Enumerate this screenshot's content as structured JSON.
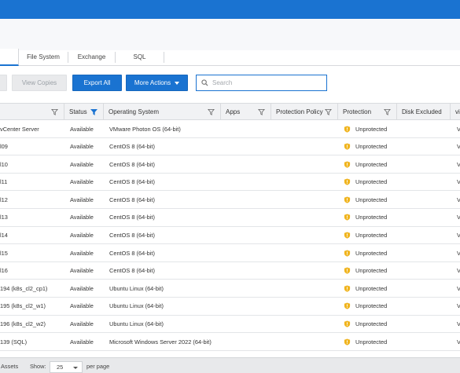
{
  "tabs": [
    {
      "label": "File System"
    },
    {
      "label": "Exchange"
    },
    {
      "label": "SQL"
    }
  ],
  "toolbar": {
    "view_copies_label": "View Copies",
    "export_all_label": "Export All",
    "more_actions_label": "More Actions",
    "search_placeholder": "Search"
  },
  "columns": {
    "status": "Status",
    "operating_system": "Operating System",
    "apps": "Apps",
    "protection_policy": "Protection Policy",
    "protection": "Protection",
    "disk_excluded": "Disk Excluded",
    "last": "vi"
  },
  "rows": [
    {
      "name": "vCenter Server",
      "status": "Available",
      "os": "VMware Photon OS (64-bit)",
      "protection": "Unprotected",
      "last": "V"
    },
    {
      "name": "l09",
      "status": "Available",
      "os": "CentOS 8 (64-bit)",
      "protection": "Unprotected",
      "last": "V"
    },
    {
      "name": "l10",
      "status": "Available",
      "os": "CentOS 8 (64-bit)",
      "protection": "Unprotected",
      "last": "V"
    },
    {
      "name": "l11",
      "status": "Available",
      "os": "CentOS 8 (64-bit)",
      "protection": "Unprotected",
      "last": "V"
    },
    {
      "name": "l12",
      "status": "Available",
      "os": "CentOS 8 (64-bit)",
      "protection": "Unprotected",
      "last": "V"
    },
    {
      "name": "l13",
      "status": "Available",
      "os": "CentOS 8 (64-bit)",
      "protection": "Unprotected",
      "last": "V"
    },
    {
      "name": "l14",
      "status": "Available",
      "os": "CentOS 8 (64-bit)",
      "protection": "Unprotected",
      "last": "V"
    },
    {
      "name": "l15",
      "status": "Available",
      "os": "CentOS 8 (64-bit)",
      "protection": "Unprotected",
      "last": "V"
    },
    {
      "name": "l16",
      "status": "Available",
      "os": "CentOS 8 (64-bit)",
      "protection": "Unprotected",
      "last": "V"
    },
    {
      "name": "194 (k8s_cl2_cp1)",
      "status": "Available",
      "os": "Ubuntu Linux (64-bit)",
      "protection": "Unprotected",
      "last": "V"
    },
    {
      "name": "195 (k8s_cl2_w1)",
      "status": "Available",
      "os": "Ubuntu Linux (64-bit)",
      "protection": "Unprotected",
      "last": "V"
    },
    {
      "name": "196 (k8s_cl2_w2)",
      "status": "Available",
      "os": "Ubuntu Linux (64-bit)",
      "protection": "Unprotected",
      "last": "V"
    },
    {
      "name": "139 (SQL)",
      "status": "Available",
      "os": "Microsoft Windows Server 2022 (64-bit)",
      "protection": "Unprotected",
      "last": "V"
    }
  ],
  "footer": {
    "assets_label": "Assets",
    "show_label": "Show:",
    "page_size": "25",
    "per_page_label": "per page"
  },
  "colors": {
    "accent": "#1a73d1",
    "warning_shield": "#f0b41e",
    "active_filter": "#1a73d1"
  },
  "icons": {
    "filter": "filter-icon",
    "search": "search-icon",
    "shield": "shield-warning-icon",
    "caret": "chevron-down-icon"
  }
}
